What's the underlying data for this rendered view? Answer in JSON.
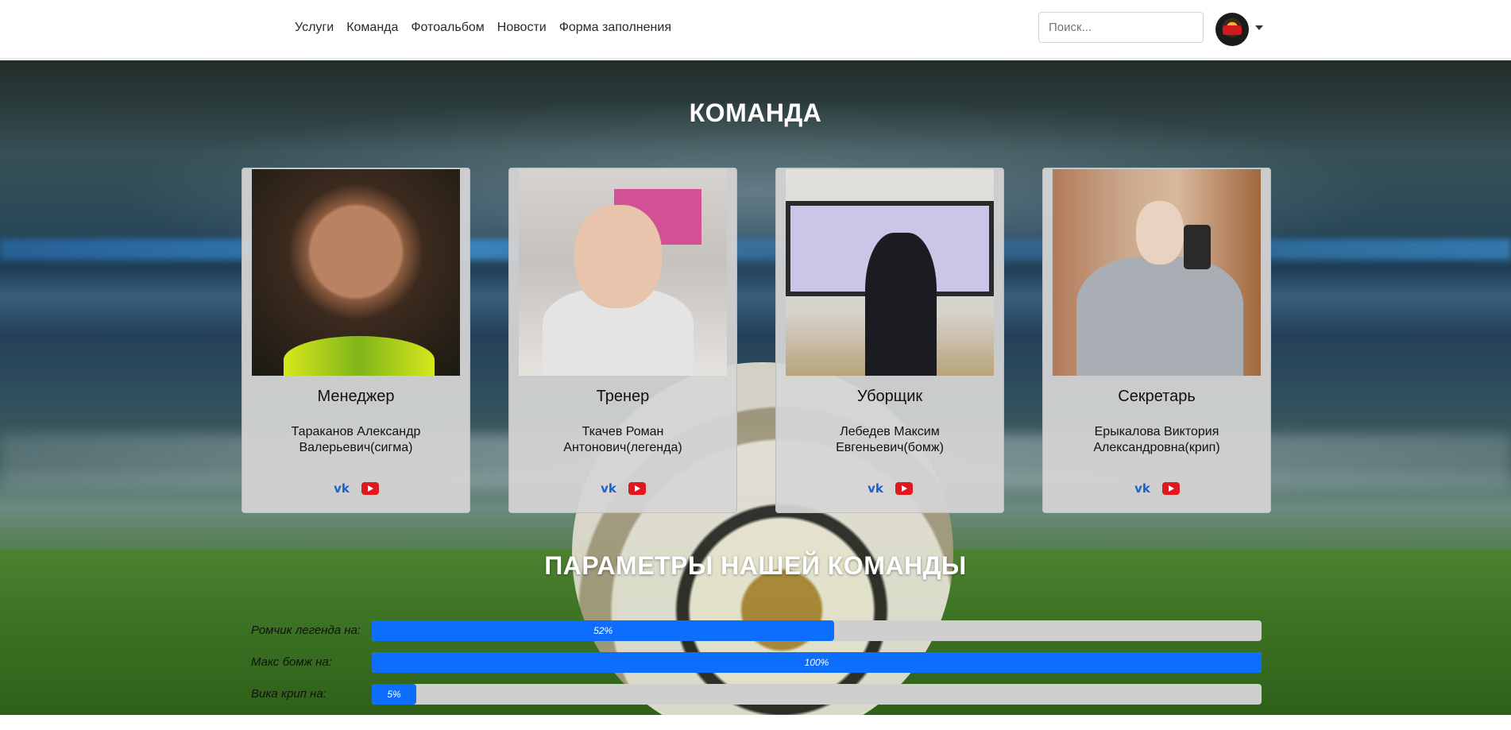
{
  "nav": {
    "links": [
      "Услуги",
      "Команда",
      "Фотоальбом",
      "Новости",
      "Форма заполнения"
    ],
    "search_placeholder": "Поиск..."
  },
  "team": {
    "title": "КОМАНДА",
    "cards": [
      {
        "role": "Менеджер",
        "name": "Тараканов Александр Валерьевич(сигма)"
      },
      {
        "role": "Тренер",
        "name": "Ткачев Роман Антонович(легенда)"
      },
      {
        "role": "Уборщик",
        "name": "Лебедев Максим Евгеньевич(бомж)"
      },
      {
        "role": "Секретарь",
        "name": "Ерыкалова Виктория Александровна(крип)"
      }
    ],
    "icons": {
      "vk": "vk-icon",
      "youtube": "youtube-icon"
    }
  },
  "params": {
    "title": "ПАРАМЕТРЫ НАШЕЙ КОМАНДЫ",
    "bars": [
      {
        "label": "Ромчик легенда на:",
        "value": 52,
        "text": "52%"
      },
      {
        "label": "Макс бомж на:",
        "value": 100,
        "text": "100%"
      },
      {
        "label": "Вика крип на:",
        "value": 5,
        "text": "5%"
      }
    ]
  },
  "colors": {
    "accent": "#0d6efd",
    "vk": "#1e5fc9",
    "youtube": "#e0181f"
  }
}
